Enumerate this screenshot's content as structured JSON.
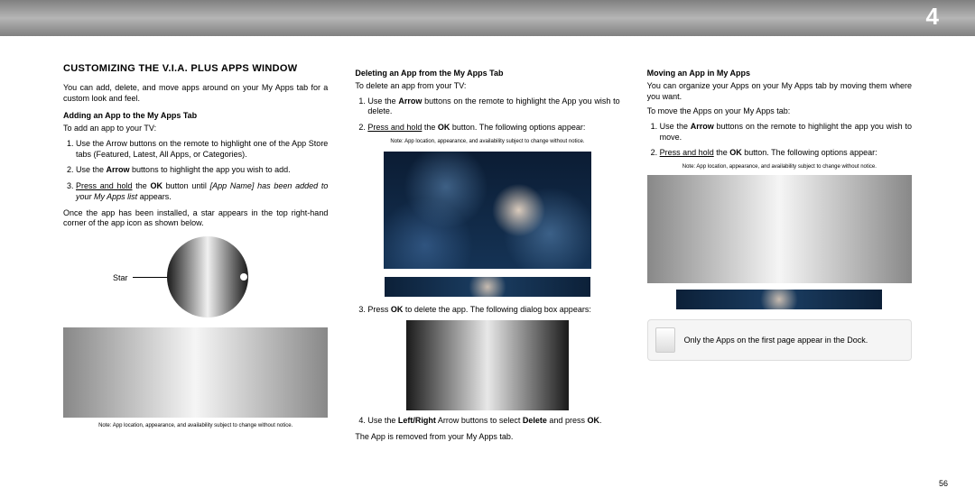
{
  "chapter": "4",
  "pageNumber": "56",
  "col1": {
    "title": "CUSTOMIZING THE V.I.A. PLUS APPS WINDOW",
    "intro": "You can add, delete, and move apps around on your My Apps tab for a custom look and feel.",
    "subhead": "Adding an App to the My Apps Tab",
    "lead": "To add an app to your TV:",
    "step1a": "Use the Arrow buttons on the remote to highlight one of the App Store tabs (Featured, Latest, All Apps, or Categories).",
    "step1b_pre": "Use the ",
    "step1b_bold": "Arrow",
    "step1b_post": " buttons to highlight the app you wish to add.",
    "step2_u": "Press and hold",
    "step2_a": " the ",
    "step2_b": "OK",
    "step2_c": " button until ",
    "step2_i": "[App Name] has been added to your My Apps list",
    "step2_d": " appears.",
    "after": "Once the app has been installed, a star appears in the top right-hand corner of the app icon as shown below.",
    "starLabel": "Star",
    "note": "Note: App location, appearance, and availability subject to change without notice."
  },
  "col2": {
    "subhead": "Deleting an App from the My Apps Tab",
    "lead": "To delete an app from your TV:",
    "s1_pre": "Use the ",
    "s1_b": "Arrow",
    "s1_post": " buttons on the remote to highlight the App you wish to delete.",
    "s2_u": "Press and hold",
    "s2_a": " the ",
    "s2_b": "OK",
    "s2_c": " button. The following options appear:",
    "note": "Note: App location, appearance, and availability subject to change without notice.",
    "s3_a": "Press ",
    "s3_b": "OK",
    "s3_c": " to delete the app. The following dialog box appears:",
    "s4_a": "Use the ",
    "s4_b": "Left/Right",
    "s4_c": " Arrow buttons to select ",
    "s4_d": "Delete",
    "s4_e": " and press ",
    "s4_f": "OK",
    "s4_g": ".",
    "end": "The App is removed from your My Apps tab."
  },
  "col3": {
    "subhead": "Moving an App in My Apps",
    "intro": "You can organize your Apps on your My Apps tab by moving them where you want.",
    "lead": "To move the Apps on your My Apps tab:",
    "s1_pre": "Use the ",
    "s1_b": "Arrow",
    "s1_post": " buttons on the remote to highlight the app you wish to move.",
    "s2_u": "Press and hold",
    "s2_a": " the ",
    "s2_b": "OK",
    "s2_c": " button. The following options appear:",
    "note": "Note: App location, appearance, and availability subject to change without notice.",
    "callout": "Only the Apps on the first page appear in the Dock."
  }
}
